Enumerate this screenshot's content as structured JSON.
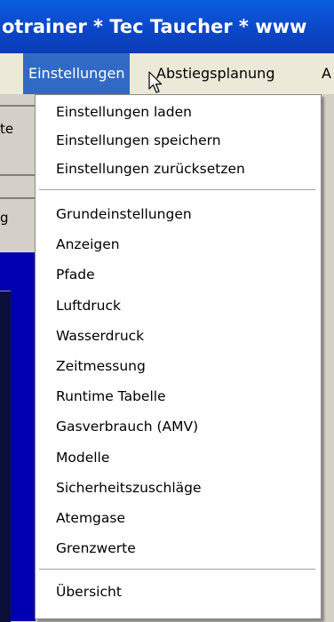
{
  "window": {
    "title": "otrainer * Tec Taucher * www"
  },
  "menubar": {
    "items": [
      {
        "label": "Einstellungen"
      },
      {
        "label": "Abstiegsplanung"
      },
      {
        "label": "A"
      }
    ]
  },
  "background": {
    "left_labels": [
      "te",
      "g"
    ],
    "accent_colors": {
      "menu_highlight": "#316ac5",
      "blue_area": "#0000b0"
    }
  },
  "dropdown": {
    "group1": [
      {
        "label": "Einstellungen laden"
      },
      {
        "label": "Einstellungen speichern"
      },
      {
        "label": "Einstellungen zurücksetzen"
      }
    ],
    "group2": [
      {
        "label": "Grundeinstellungen"
      },
      {
        "label": "Anzeigen"
      },
      {
        "label": "Pfade"
      },
      {
        "label": "Luftdruck"
      },
      {
        "label": "Wasserdruck"
      },
      {
        "label": "Zeitmessung"
      },
      {
        "label": "Runtime Tabelle"
      },
      {
        "label": "Gasverbrauch (AMV)"
      },
      {
        "label": "Modelle"
      },
      {
        "label": "Sicherheitszuschläge"
      },
      {
        "label": "Atemgase"
      },
      {
        "label": "Grenzwerte"
      }
    ],
    "group3": [
      {
        "label": "Übersicht"
      }
    ]
  }
}
